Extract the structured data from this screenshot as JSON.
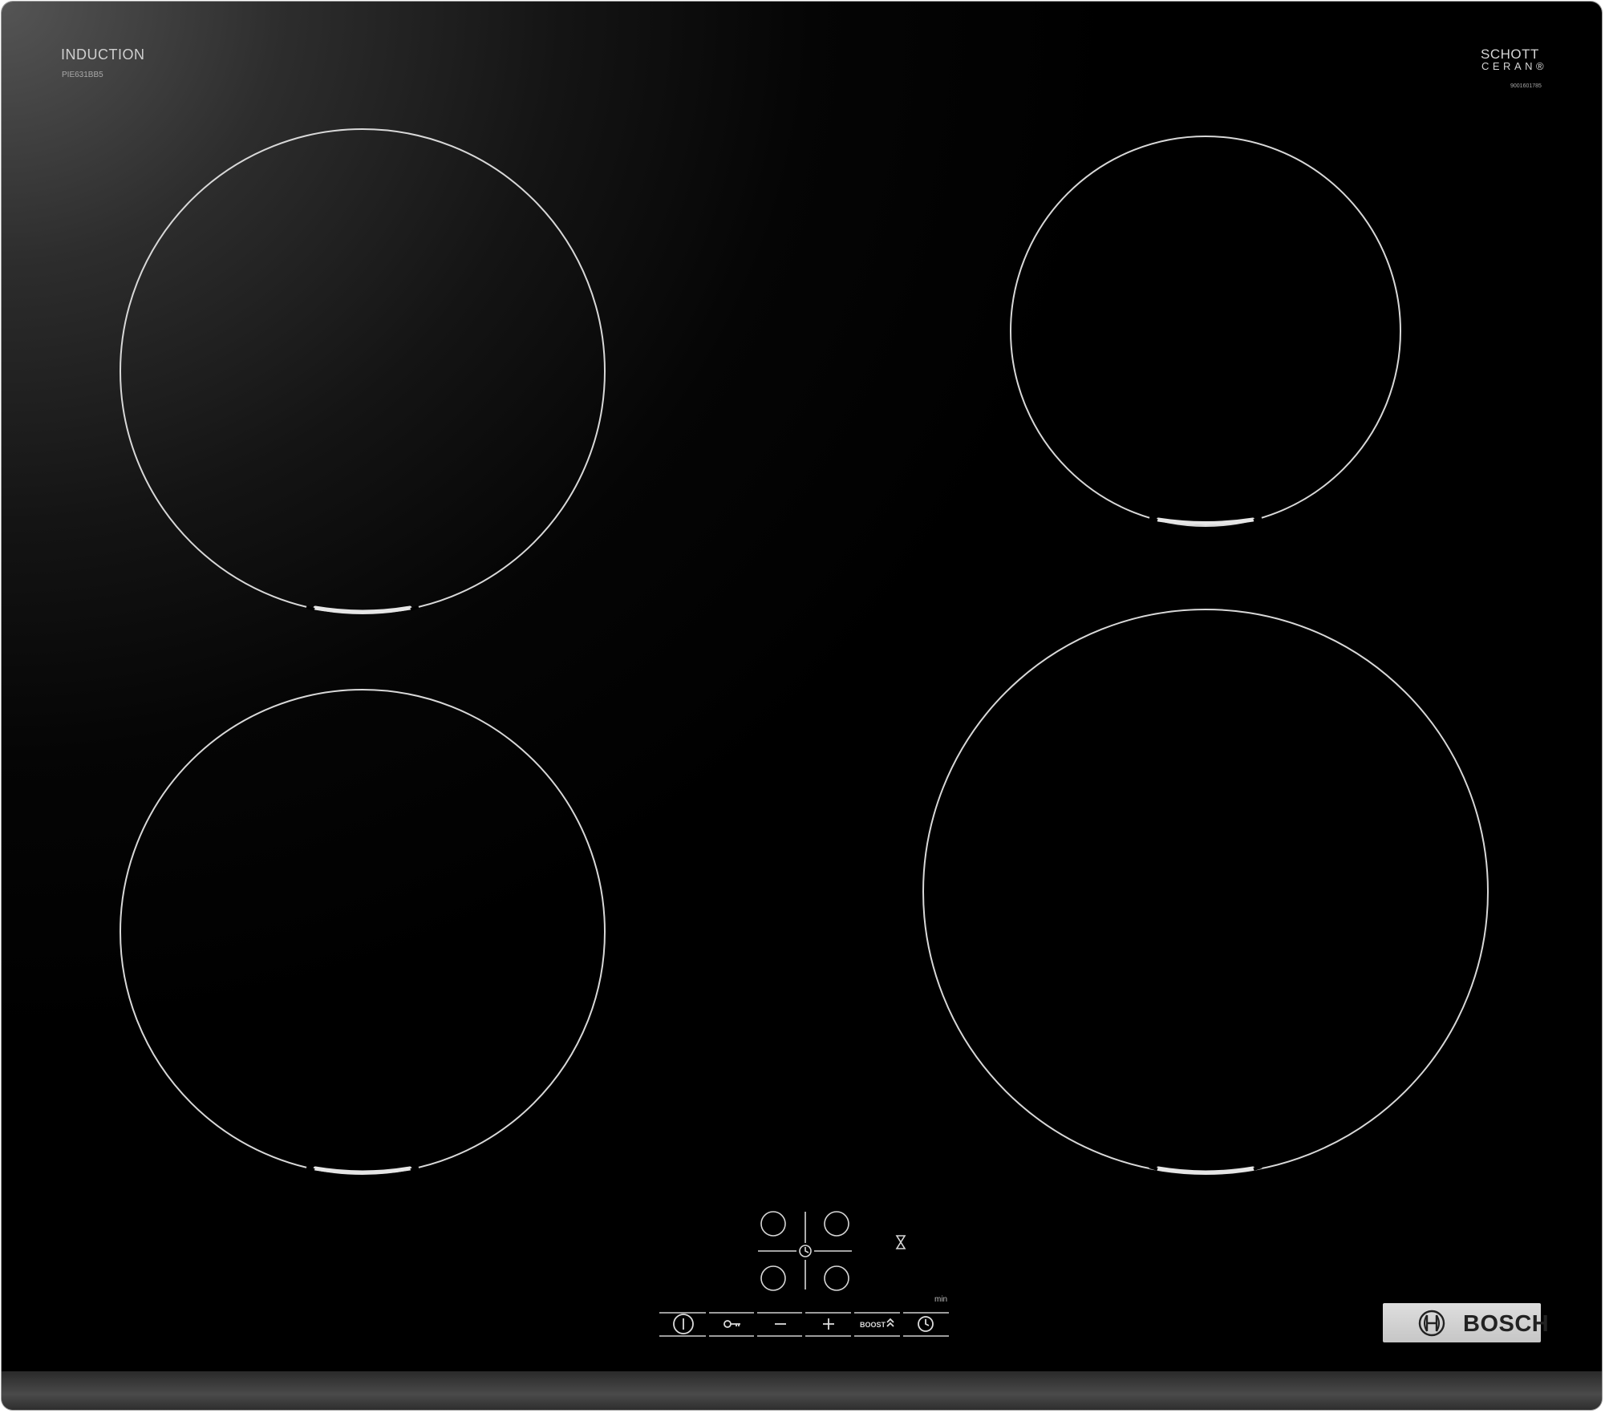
{
  "branding": {
    "induction_label": "INDUCTION",
    "model_number": "PIE631BB5",
    "schott_line1": "SCHOTT",
    "schott_line2": "CERAN®",
    "serial_number": "9001601785",
    "brand_name": "BOSCH"
  },
  "zones": [
    {
      "id": "front-left-zone",
      "position": "top-left"
    },
    {
      "id": "rear-left-zone",
      "position": "bottom-left"
    },
    {
      "id": "small-right-zone",
      "position": "top-right"
    },
    {
      "id": "large-right-zone",
      "position": "bottom-right"
    }
  ],
  "controls": {
    "power_icon": "power-icon",
    "lock_icon": "key-icon",
    "minus_icon": "minus-icon",
    "plus_icon": "plus-icon",
    "boost_label": "BOOST",
    "timer_icon": "clock-icon",
    "timer_unit": "min"
  },
  "colors": {
    "glass": "#000000",
    "ring": "#d8d8d8",
    "badge": "#d4d4d4"
  }
}
